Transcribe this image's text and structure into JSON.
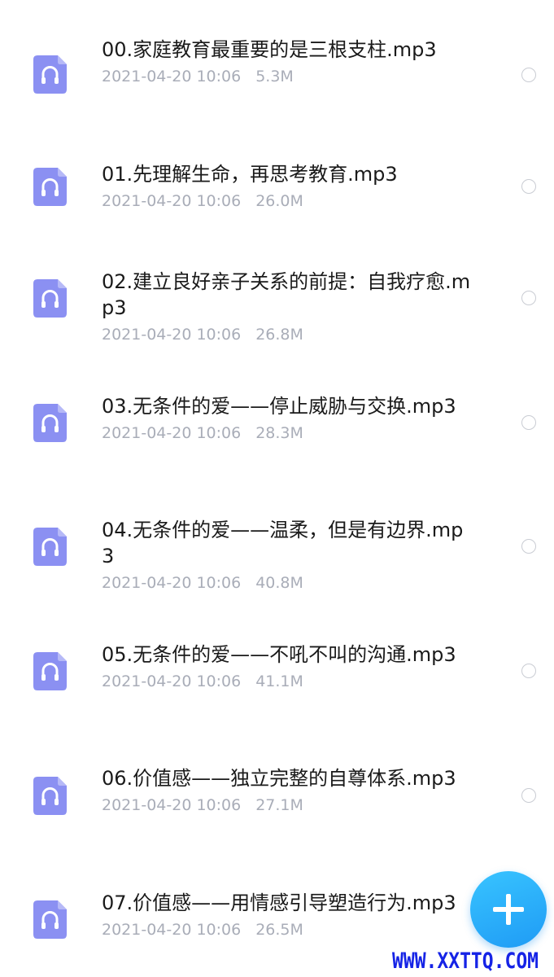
{
  "files": [
    {
      "name": "00.家庭教育最重要的是三根支柱.mp3",
      "date": "2021-04-20 10:06",
      "size": "5.3M",
      "icon": "audio-file-icon"
    },
    {
      "name": "01.先理解生命，再思考教育.mp3",
      "date": "2021-04-20 10:06",
      "size": "26.0M",
      "icon": "audio-file-icon"
    },
    {
      "name": "02.建立良好亲子关系的前提：自我疗愈.mp3",
      "date": "2021-04-20 10:06",
      "size": "26.8M",
      "icon": "audio-file-icon"
    },
    {
      "name": "03.无条件的爱——停止威胁与交换.mp3",
      "date": "2021-04-20 10:06",
      "size": "28.3M",
      "icon": "audio-file-icon"
    },
    {
      "name": "04.无条件的爱——温柔，但是有边界.mp3",
      "date": "2021-04-20 10:06",
      "size": "40.8M",
      "icon": "audio-file-icon"
    },
    {
      "name": "05.无条件的爱——不吼不叫的沟通.mp3",
      "date": "2021-04-20 10:06",
      "size": "41.1M",
      "icon": "audio-file-icon"
    },
    {
      "name": "06.价值感——独立完整的自尊体系.mp3",
      "date": "2021-04-20 10:06",
      "size": "27.1M",
      "icon": "audio-file-icon"
    },
    {
      "name": "07.价值感——用情感引导塑造行为.mp3",
      "date": "2021-04-20 10:06",
      "size": "26.5M",
      "icon": "audio-file-icon"
    }
  ],
  "fab": {
    "icon": "plus-icon"
  },
  "watermark": "WWW.XXTTQ.COM",
  "colors": {
    "icon_fill": "#8b90f2",
    "fab": "#2aaaf8",
    "meta_text": "#a9adb8",
    "watermark": "#1523e6"
  }
}
